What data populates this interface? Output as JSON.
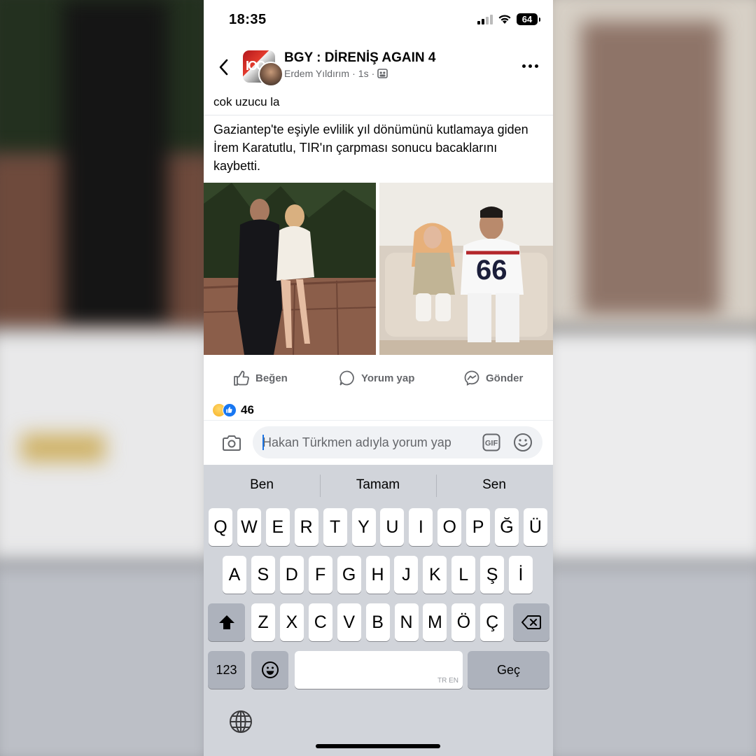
{
  "status_bar": {
    "time": "18:35",
    "battery": "64"
  },
  "post": {
    "group_name": "BGY : DİRENİŞ AGAIN 4",
    "author": "Erdem Yıldırım",
    "time": "1s",
    "separator": "·",
    "caption": "cok uzucu la",
    "shared_text": "Gaziantep'te eşiyle evlilik yıl dönümünü kutlamaya giden İrem Karatutlu, TIR'ın çarpması sonucu bacaklarını kaybetti."
  },
  "actions": {
    "like": "Beğen",
    "comment": "Yorum yap",
    "send": "Gönder"
  },
  "reactions": {
    "count": "46"
  },
  "comment_box": {
    "placeholder": "Hakan Türkmen adıyla yorum yap",
    "gif_label": "GIF"
  },
  "keyboard": {
    "suggestions": [
      "Ben",
      "Tamam",
      "Sen"
    ],
    "row1": [
      "Q",
      "W",
      "E",
      "R",
      "T",
      "Y",
      "U",
      "I",
      "O",
      "P",
      "Ğ",
      "Ü"
    ],
    "row2": [
      "A",
      "S",
      "D",
      "F",
      "G",
      "H",
      "J",
      "K",
      "L",
      "Ş",
      "İ"
    ],
    "row3": [
      "Z",
      "X",
      "C",
      "V",
      "B",
      "N",
      "M",
      "Ö",
      "Ç"
    ],
    "numbers_key": "123",
    "return_key": "Geç",
    "space_hint": "TR EN"
  }
}
